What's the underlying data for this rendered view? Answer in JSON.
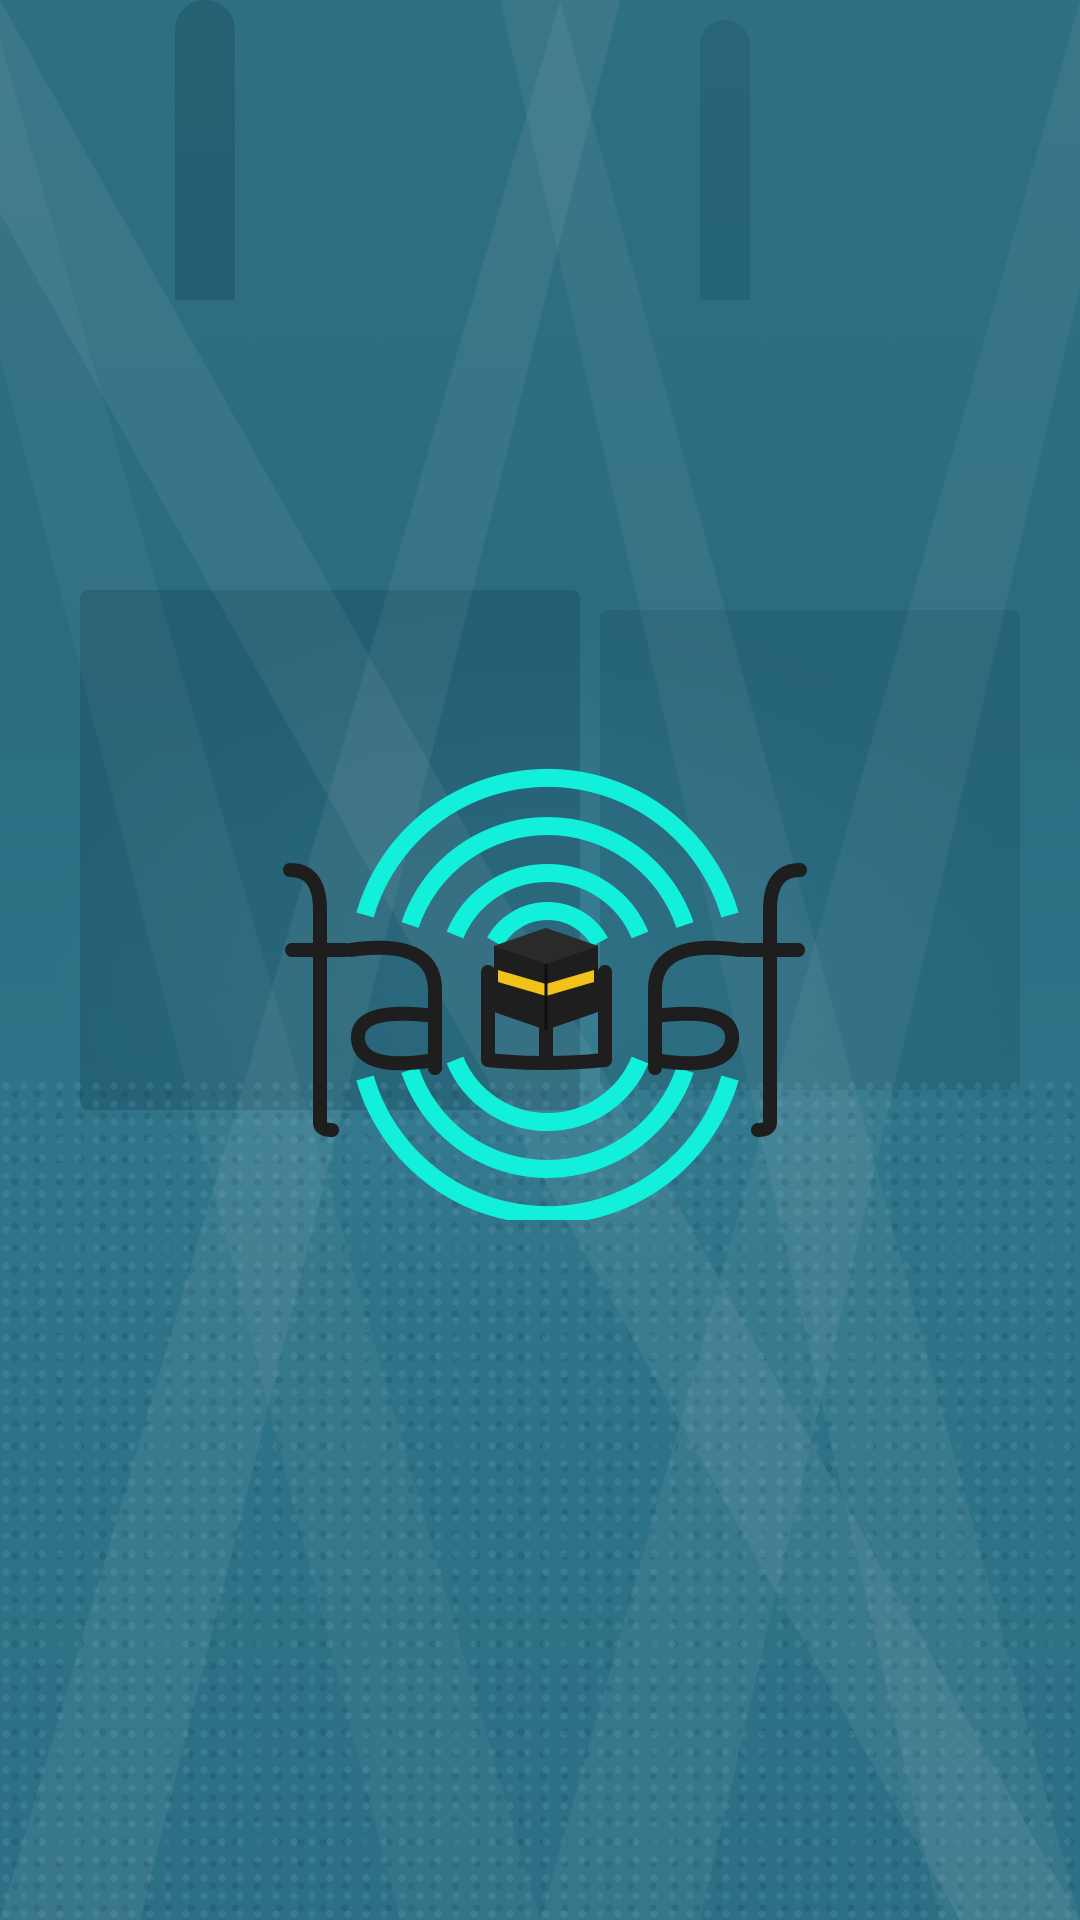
{
  "app": {
    "name": "tawaf",
    "screen": "splash"
  },
  "logo": {
    "icon": "kaaba-icon",
    "wordmark_icon": "tawaf-wordmark-logo"
  },
  "colors": {
    "background": "#2c6f83",
    "ring_accent": "#12f0dc",
    "wordmark": "#1e1e1e",
    "kaaba_band": "#f2c11a"
  }
}
